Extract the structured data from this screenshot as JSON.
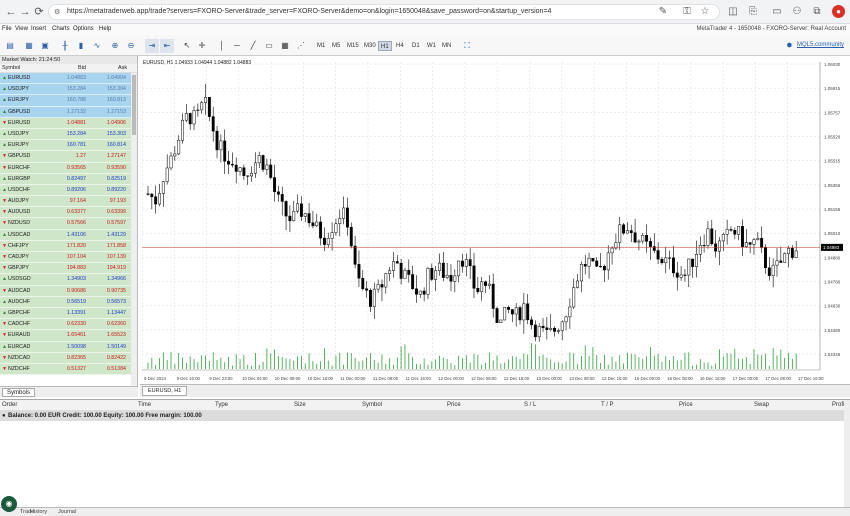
{
  "browser": {
    "url": "https://metatraderweb.app/trade?servers=FXORO-Server&trade_server=FXORO-Server&demo=on&login=1650048&save_password=on&startup_version=4"
  },
  "menu": {
    "items": [
      "File",
      "View",
      "Insert",
      "Charts",
      "Options",
      "Help"
    ],
    "status": "MetaTrader 4 - 1650048 - FXORO-Server: Real Account"
  },
  "toolbar": {
    "timeframes": [
      "M1",
      "M5",
      "M15",
      "M30",
      "H1",
      "H4",
      "D1",
      "W1",
      "MN"
    ],
    "active_timeframe": "H1",
    "mql_link": "MQL5.community"
  },
  "market_watch": {
    "title": "Market Watch: 21:24:50",
    "col_symbol": "Symbol",
    "col_bid": "Bid",
    "col_ask": "Ask",
    "rows": [
      {
        "symbol": "EURUSD",
        "bid": "1.04883",
        "ask": "1.04904",
        "dir": "up",
        "style": "blue"
      },
      {
        "symbol": "USDJPY",
        "bid": "153.284",
        "ask": "153.304",
        "dir": "up",
        "style": "blue"
      },
      {
        "symbol": "EURJPY",
        "bid": "160.788",
        "ask": "160.813",
        "dir": "up",
        "style": "blue"
      },
      {
        "symbol": "GBPUSD",
        "bid": "1.27132",
        "ask": "1.27153",
        "dir": "up",
        "style": "blue"
      },
      {
        "symbol": "EURUSD",
        "bid": "1.04881",
        "ask": "1.04906",
        "dir": "down",
        "style": "green"
      },
      {
        "symbol": "USDJPY",
        "bid": "153.284",
        "ask": "153.303",
        "dir": "up",
        "style": "green"
      },
      {
        "symbol": "EURJPY",
        "bid": "160.781",
        "ask": "160.814",
        "dir": "up",
        "style": "green"
      },
      {
        "symbol": "GBPUSD",
        "bid": "1.27",
        "ask": "1.27147",
        "dir": "down",
        "style": "green"
      },
      {
        "symbol": "EURCHF",
        "bid": "0.93565",
        "ask": "0.93590",
        "dir": "down",
        "style": "green"
      },
      {
        "symbol": "EURGBP",
        "bid": "0.82497",
        "ask": "0.82519",
        "dir": "up",
        "style": "green"
      },
      {
        "symbol": "USDCHF",
        "bid": "0.89206",
        "ask": "0.89220",
        "dir": "up",
        "style": "green"
      },
      {
        "symbol": "AUDJPY",
        "bid": "97.164",
        "ask": "97.193",
        "dir": "down",
        "style": "green"
      },
      {
        "symbol": "AUDUSD",
        "bid": "0.63377",
        "ask": "0.63399",
        "dir": "down",
        "style": "green"
      },
      {
        "symbol": "NZDUSD",
        "bid": "0.57566",
        "ask": "0.57597",
        "dir": "down",
        "style": "green"
      },
      {
        "symbol": "USDCAD",
        "bid": "1.43106",
        "ask": "1.43129",
        "dir": "up",
        "style": "green"
      },
      {
        "symbol": "CHFJPY",
        "bid": "171.820",
        "ask": "171.858",
        "dir": "down",
        "style": "green"
      },
      {
        "symbol": "CADJPY",
        "bid": "107.104",
        "ask": "107.139",
        "dir": "down",
        "style": "green"
      },
      {
        "symbol": "GBPJPY",
        "bid": "194.883",
        "ask": "194.919",
        "dir": "down",
        "style": "green"
      },
      {
        "symbol": "USDSGD",
        "bid": "1.34903",
        "ask": "1.34966",
        "dir": "up",
        "style": "green"
      },
      {
        "symbol": "AUDCAD",
        "bid": "0.90686",
        "ask": "0.90735",
        "dir": "down",
        "style": "green"
      },
      {
        "symbol": "AUDCHF",
        "bid": "0.56519",
        "ask": "0.56573",
        "dir": "up",
        "style": "green"
      },
      {
        "symbol": "GBPCHF",
        "bid": "1.13391",
        "ask": "1.13447",
        "dir": "up",
        "style": "green"
      },
      {
        "symbol": "CADCHF",
        "bid": "0.62330",
        "ask": "0.62360",
        "dir": "down",
        "style": "green"
      },
      {
        "symbol": "EURAUD",
        "bid": "1.65461",
        "ask": "1.65523",
        "dir": "down",
        "style": "green"
      },
      {
        "symbol": "EURCAD",
        "bid": "1.50098",
        "ask": "1.50149",
        "dir": "up",
        "style": "green"
      },
      {
        "symbol": "NZDCAD",
        "bid": "0.82365",
        "ask": "0.82422",
        "dir": "down",
        "style": "green"
      },
      {
        "symbol": "NZDCHF",
        "bid": "0.51327",
        "ask": "0.51384",
        "dir": "down",
        "style": "green"
      }
    ],
    "tab": "Symbols"
  },
  "chart": {
    "header": "EURUSD, H1  1.04933 1.04944 1.04882 1.04883",
    "tab": "EURUSD, H1",
    "current_price": "1.04883",
    "price_ticks": [
      "1.06030",
      "1.05915",
      "1.05757",
      "1.05520",
      "1.05515",
      "1.05355",
      "1.05155",
      "1.05010",
      "1.04880",
      "1.04780",
      "1.04630",
      "1.04480",
      "1.04345"
    ],
    "time_ticks": [
      "9 Dec 2024",
      "9 Dec 16:00",
      "9 Dec 23:00",
      "10 Dec 04:00",
      "10 Dec 08:00",
      "10 Dec 16:00",
      "11 Dec 00:00",
      "11 Dec 08:00",
      "11 Dec 16:00",
      "12 Dec 00:00",
      "12 Dec 08:00",
      "12 Dec 16:00",
      "13 Dec 00:00",
      "13 Dec 08:00",
      "13 Dec 16:00",
      "16 Dec 00:00",
      "16 Dec 08:00",
      "16 Dec 16:00",
      "17 Dec 00:00",
      "17 Dec 08:00",
      "17 Dec 16:00"
    ]
  },
  "chart_data": {
    "type": "candlestick",
    "title": "EURUSD, H1",
    "ylim": [
      1.043,
      1.0605
    ],
    "close_path": [
      1.0522,
      1.0518,
      1.0535,
      1.0545,
      1.056,
      1.0572,
      1.0568,
      1.058,
      1.0565,
      1.055,
      1.0545,
      1.0542,
      1.0535,
      1.054,
      1.0545,
      1.0538,
      1.052,
      1.051,
      1.0505,
      1.0512,
      1.0508,
      1.05,
      1.0495,
      1.0502,
      1.051,
      1.0505,
      1.047,
      1.046,
      1.0455,
      1.0462,
      1.0475,
      1.048,
      1.047,
      1.0465,
      1.0458,
      1.047,
      1.0475,
      1.0472,
      1.047,
      1.0485,
      1.0475,
      1.046,
      1.0468,
      1.0455,
      1.044,
      1.0448,
      1.0445,
      1.0452,
      1.044,
      1.0435,
      1.0432,
      1.0438,
      1.0445,
      1.046,
      1.0475,
      1.048,
      1.047,
      1.0478,
      1.0492,
      1.0498,
      1.0502,
      1.0495,
      1.049,
      1.0485,
      1.0482,
      1.0478,
      1.0475,
      1.047,
      1.048,
      1.0492,
      1.0498,
      1.0488,
      1.0492,
      1.05,
      1.0495,
      1.0488,
      1.0492,
      1.048,
      1.0472,
      1.0478,
      1.0486,
      1.0488
    ],
    "current_price": 1.04883
  },
  "terminal": {
    "columns": [
      "Order",
      "Time",
      "Type",
      "Size",
      "Symbol",
      "Price",
      "S / L",
      "T / P",
      "Price",
      "Swap",
      "Profit"
    ],
    "balance_line": "Balance: 0.00 EUR  Credit: 100.00  Equity: 100.00  Free margin: 100.00",
    "tabs": [
      "Trade",
      "History",
      "Journal"
    ]
  },
  "colors": {
    "blue_row": "#a8d4f0",
    "green_row": "#cfe6c8",
    "up_arrow": "#2a8a2a",
    "down_arrow": "#d02020",
    "bid_blue": "#1a3cc8",
    "bid_red": "#c81a1a",
    "price_line": "#c0392b",
    "volume": "#2e9e3a"
  }
}
